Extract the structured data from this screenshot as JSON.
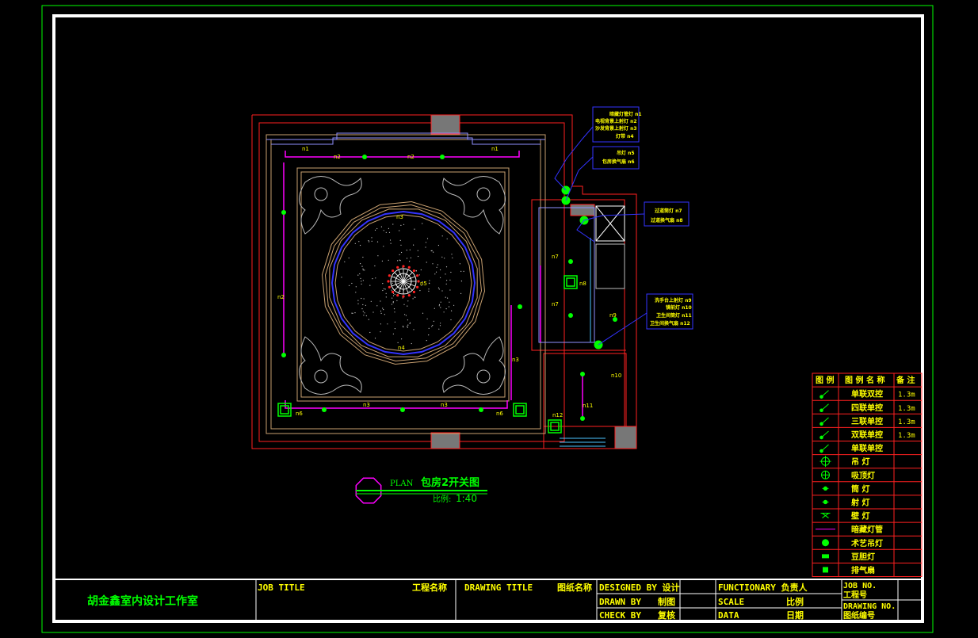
{
  "studio_name": "胡金鑫室内设计工作室",
  "title_block": {
    "job_title_label": "JOB TITLE",
    "job_title_cn": "工程名称",
    "drawing_title_label": "DRAWING TITLE",
    "drawing_title_cn": "图纸名称",
    "designed_by": "DESIGNED BY 设计",
    "drawn_by_label": "DRAWN BY",
    "drawn_by_cn": "制图",
    "check_by_label": "CHECK BY",
    "check_by_cn": "复核",
    "functionary": "FUNCTIONARY 负责人",
    "scale_label": "SCALE",
    "scale_cn": "比例",
    "data_label": "DATA",
    "data_cn": "日期",
    "job_no_label": "JOB NO.",
    "job_no_cn": "工程号",
    "drawing_no_label": "DRAWING NO.",
    "drawing_no_cn": "图纸编号"
  },
  "plan_caption": {
    "prefix": "PLAN",
    "title": "包房2开关图",
    "scale_label": "比例:",
    "scale_value": "1:40"
  },
  "legend": {
    "headers": [
      "图 例",
      "图 例 名 称",
      "备 注"
    ],
    "rows": [
      {
        "icon": "single-switch-icon",
        "name": "单联双控",
        "note": "1.3m"
      },
      {
        "icon": "quad-switch-icon",
        "name": "四联单控",
        "note": "1.3m"
      },
      {
        "icon": "triple-switch-icon",
        "name": "三联单控",
        "note": "1.3m"
      },
      {
        "icon": "double-switch-icon",
        "name": "双联单控",
        "note": "1.3m"
      },
      {
        "icon": "single-switch-icon",
        "name": "单联单控",
        "note": ""
      },
      {
        "icon": "pendant-lamp-icon",
        "name": "吊 灯",
        "note": ""
      },
      {
        "icon": "ceiling-lamp-icon",
        "name": "吸顶灯",
        "note": ""
      },
      {
        "icon": "downlight-icon",
        "name": "筒 灯",
        "note": ""
      },
      {
        "icon": "spotlight-icon",
        "name": "射 灯",
        "note": ""
      },
      {
        "icon": "wall-lamp-icon",
        "name": "壁 灯",
        "note": ""
      },
      {
        "icon": "concealed-tube-icon",
        "name": "暗藏灯管",
        "note": ""
      },
      {
        "icon": "art-pendant-icon",
        "name": "术艺吊灯",
        "note": ""
      },
      {
        "icon": "bean-lamp-icon",
        "name": "豆胆灯",
        "note": ""
      },
      {
        "icon": "exhaust-fan-icon",
        "name": "排气扇",
        "note": ""
      }
    ]
  },
  "callouts": {
    "box1": [
      "暗藏灯管灯 n1",
      "电视背景上射灯 n2",
      "沙发背景上射灯 n3",
      "灯带 n4"
    ],
    "box2": [
      "吊灯 n5",
      "包房换气扇 n6"
    ],
    "box3": [
      "过道筒灯 n7",
      "过道换气扇 n8"
    ],
    "box4": [
      "洗手台上射灯 n9",
      "镜前灯 n10",
      "卫生间筒灯 n11",
      "卫生间换气扇 n12"
    ]
  },
  "circuit_labels": {
    "n1": "n1",
    "n2": "n2",
    "n3": "n3",
    "n4": "n4",
    "n5": "n5",
    "n6": "n6",
    "n7": "n7",
    "n8": "n8",
    "n9": "n9",
    "n10": "n10",
    "n11": "n11",
    "n12": "n12"
  },
  "colors": {
    "sheet_border": "#00ff00",
    "frame": "#ffffff",
    "wall": "#ff2020",
    "circuit": "#ff00ff",
    "callout": "#3333ff",
    "label": "#ffff00",
    "ceiling_trim": "#c8a070",
    "fixture": "#00ff00"
  }
}
